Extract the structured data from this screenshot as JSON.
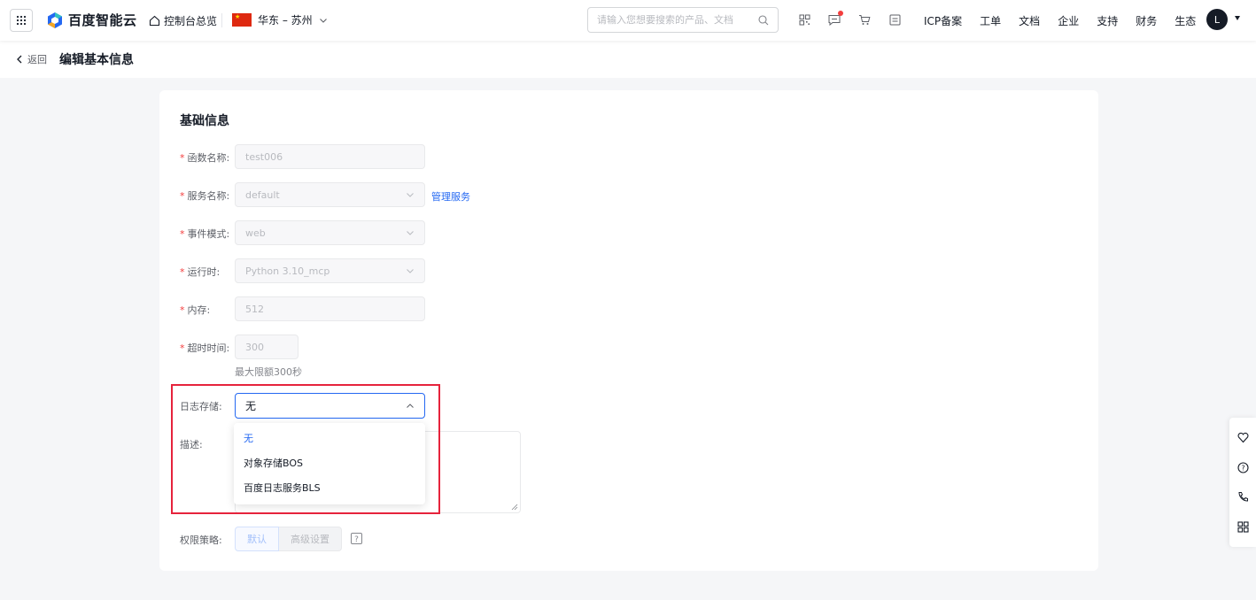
{
  "topnav": {
    "brand": "百度智能云",
    "console_label": "控制台总览",
    "region": "华东 – 苏州",
    "search_placeholder": "请输入您想要搜索的产品、文档",
    "links": [
      "ICP备案",
      "工单",
      "文档",
      "企业",
      "支持",
      "财务",
      "生态"
    ],
    "avatar_initial": "L",
    "icons": [
      "qrcode-icon",
      "message-icon",
      "cart-icon",
      "billing-icon"
    ]
  },
  "header": {
    "back_label": "返回",
    "title": "编辑基本信息"
  },
  "form": {
    "section_title": "基础信息",
    "function_name": {
      "label": "函数名称:",
      "value": "test006"
    },
    "service_name": {
      "label": "服务名称:",
      "value": "default",
      "link": "管理服务"
    },
    "event_mode": {
      "label": "事件模式:",
      "value": "web"
    },
    "runtime": {
      "label": "运行时:",
      "value": "Python 3.10_mcp"
    },
    "memory": {
      "label": "内存:",
      "value": "512"
    },
    "timeout": {
      "label": "超时时间:",
      "value": "300",
      "hint": "最大限额300秒"
    },
    "log_storage": {
      "label": "日志存储:",
      "value": "无",
      "options": [
        "无",
        "对象存储BOS",
        "百度日志服务BLS"
      ]
    },
    "description": {
      "label": "描述:"
    },
    "permission": {
      "label": "权限策略:",
      "default_label": "默认",
      "advanced_label": "高级设置"
    }
  },
  "colors": {
    "accent": "#2468f2",
    "required": "#f33e3e",
    "highlight": "#e6233c"
  }
}
